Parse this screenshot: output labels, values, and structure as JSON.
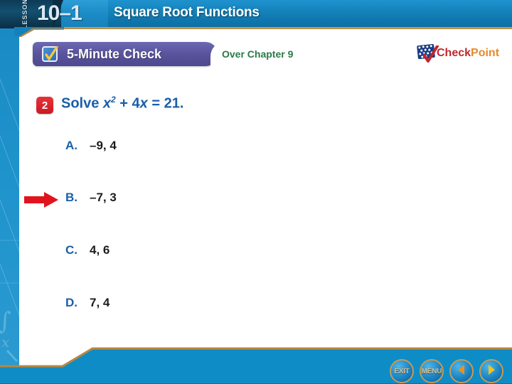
{
  "header": {
    "lesson_label": "LESSON",
    "lesson_number": "10–1",
    "title": "Square Root Functions"
  },
  "banner": {
    "check_label": "5-Minute Check",
    "check_icon": "checkbox-checked-icon",
    "over_chapter": "Over Chapter 9"
  },
  "logo": {
    "check_word": "Check",
    "point_word": "Point",
    "flag_icon": "flag-stars-icon",
    "checkmark_icon": "red-checkmark-icon"
  },
  "question": {
    "number": "2",
    "prompt_prefix": "Solve ",
    "expression_base": "x",
    "expression_exp": "2",
    "expression_rest": " + 4",
    "expression_var2": "x",
    "expression_tail": " = 21.",
    "full_text": "Solve x2 + 4x = 21.",
    "options": [
      {
        "letter": "A.",
        "value": "–9, 4",
        "marked": false
      },
      {
        "letter": "B.",
        "value": "–7, 3",
        "marked": true
      },
      {
        "letter": "C.",
        "value": "4, 6",
        "marked": false
      },
      {
        "letter": "D.",
        "value": "7, 4",
        "marked": false
      }
    ],
    "pointer_icon": "red-right-arrow-icon"
  },
  "bottom_bar": {
    "buttons": [
      {
        "name": "exit",
        "label": "EXIT",
        "icon": ""
      },
      {
        "name": "menu",
        "label": "MENU",
        "icon": ""
      },
      {
        "name": "back",
        "label": "",
        "icon": "left-triangle-icon"
      },
      {
        "name": "next",
        "label": "",
        "icon": "right-triangle-icon"
      }
    ]
  },
  "colors": {
    "header_blue": "#1786bf",
    "strip_blue": "#1f93cc",
    "gold_rule": "#b8873f",
    "banner_purple": "#5b559f",
    "question_blue": "#1a5fa8",
    "badge_red": "#cc1823",
    "green_text": "#2a7a46",
    "logo_red": "#c0272d",
    "logo_orange": "#e8892b",
    "bottom_bar_blue": "#0e8cc6"
  }
}
